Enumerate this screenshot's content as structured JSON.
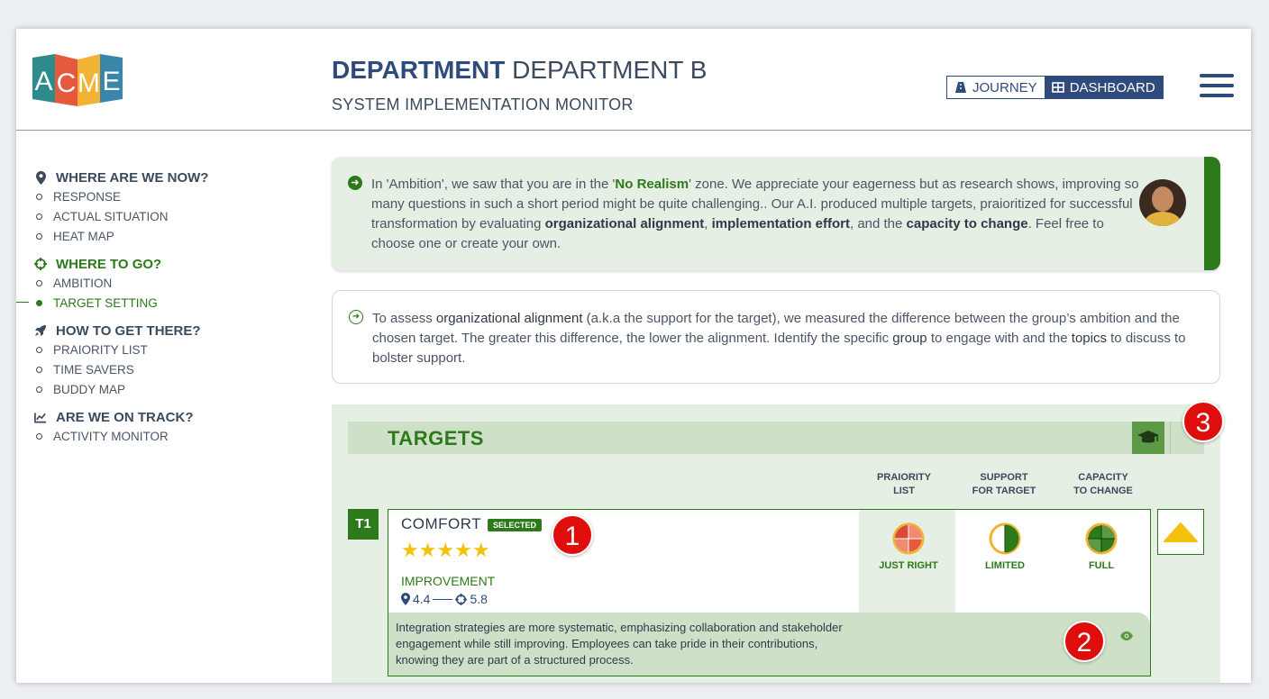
{
  "header": {
    "logo_letters": [
      "A",
      "C",
      "M",
      "E"
    ],
    "logo_colors": [
      "#2e8b8b",
      "#e55a3c",
      "#f2b233",
      "#3a86a8"
    ],
    "title_bold": "DEPARTMENT",
    "title_rest": "DEPARTMENT B",
    "subtitle": "SYSTEM IMPLEMENTATION MONITOR",
    "toggle": {
      "journey": "JOURNEY",
      "dashboard": "DASHBOARD",
      "active": "dashboard"
    }
  },
  "sidebar": {
    "sections": [
      {
        "title": "WHERE ARE WE NOW?",
        "icon": "map-pin-icon",
        "items": [
          "RESPONSE",
          "ACTUAL SITUATION",
          "HEAT MAP"
        ]
      },
      {
        "title": "WHERE TO GO?",
        "icon": "crosshair-icon",
        "items": [
          "AMBITION",
          "TARGET SETTING"
        ],
        "active_item": "TARGET SETTING"
      },
      {
        "title": "HOW TO GET THERE?",
        "icon": "rocket-icon",
        "items": [
          "PRAIORITY LIST",
          "TIME SAVERS",
          "BUDDY MAP"
        ]
      },
      {
        "title": "ARE WE ON TRACK?",
        "icon": "chart-line-icon",
        "items": [
          "ACTIVITY MONITOR"
        ]
      }
    ]
  },
  "info1": {
    "p1": "In 'Ambition', we saw that you are in the '",
    "zone": "No Realism",
    "p2": "' zone. We appreciate your eagerness but as research shows, improving so many questions in such a short period might be quite challenging.. Our A.I. produced multiple targets, praioritized for successful transformation by evaluating ",
    "b1": "organizational alignment",
    "p3": ", ",
    "b2": "implementation effort",
    "p4": ", and the ",
    "b3": "capacity to change",
    "p5": ". Feel free to choose one or create your own."
  },
  "info2": {
    "p1": "To assess ",
    "d1": "organizational alignment",
    "p2": " (a.k.a the support for the target), we measured the difference between the group’s ambition and the chosen target. The greater this difference, the lower the alignment. Identify the specific ",
    "d2": "group",
    "p3": " to engage with and the ",
    "d3": "topics",
    "p4": " to discuss to bolster support."
  },
  "targets": {
    "title": "TARGETS",
    "columns": [
      {
        "l1": "PRAIORITY",
        "l2": "LIST"
      },
      {
        "l1": "SUPPORT",
        "l2": "FOR TARGET"
      },
      {
        "l1": "CAPACITY",
        "l2": "TO CHANGE"
      }
    ],
    "items": [
      {
        "id": "T1",
        "name": "COMFORT",
        "badge": "SELECTED",
        "stars": "★★★★★",
        "rating": 5,
        "improvement_label": "IMPROVEMENT",
        "from": "4.4",
        "to": "5.8",
        "metrics": [
          "JUST RIGHT",
          "LIMITED",
          "FULL"
        ],
        "description": "Integration strategies are more systematic, emphasizing collaboration and stakeholder engagement while still improving. Employees can take pride in their contributions, knowing they are part of a structured process."
      }
    ]
  },
  "callouts": [
    "1",
    "2",
    "3"
  ],
  "colors": {
    "brand_blue": "#2f4b7c",
    "brand_green": "#2d7a1a",
    "callout_red": "#e00d0d",
    "star": "#f4c20d"
  }
}
